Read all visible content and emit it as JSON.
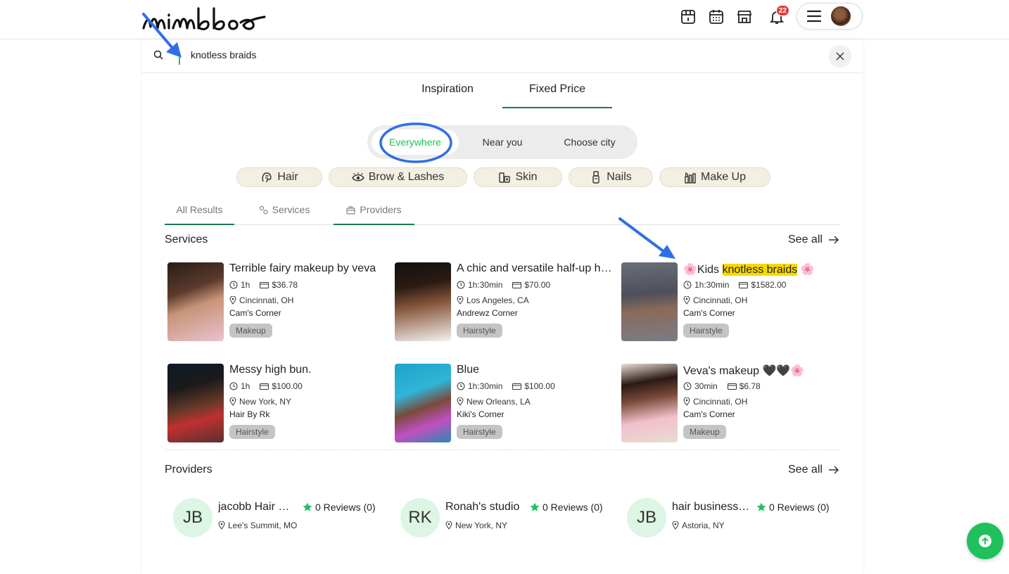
{
  "brand": {
    "logo_text": "mimbbo"
  },
  "header": {
    "nav_icons": [
      "inspiration-icon",
      "calendar-icon",
      "store-icon",
      "bell-icon"
    ],
    "notification_count": "22",
    "menu_icon": "menu-icon"
  },
  "search": {
    "query": "knotless braids",
    "clear_icon": "close-icon"
  },
  "main_tabs": [
    {
      "label": "Inspiration",
      "active": false
    },
    {
      "label": "Fixed Price",
      "active": true
    }
  ],
  "location_filter": {
    "options": [
      "Everywhere",
      "Near you",
      "Choose city"
    ],
    "selected": "Everywhere"
  },
  "categories": [
    {
      "label": "Hair",
      "icon": "hair-icon"
    },
    {
      "label": "Brow & Lashes",
      "icon": "eye-icon"
    },
    {
      "label": "Skin",
      "icon": "skincare-icon"
    },
    {
      "label": "Nails",
      "icon": "nail-polish-icon"
    },
    {
      "label": "Make Up",
      "icon": "makeup-icon"
    }
  ],
  "result_tabs": [
    {
      "label": "All Results",
      "icon": ""
    },
    {
      "label": "Services",
      "icon": "services-icon"
    },
    {
      "label": "Providers",
      "icon": "briefcase-icon"
    }
  ],
  "services_section": {
    "title": "Services",
    "see_all": "See all",
    "items": [
      {
        "title": "Terrible fairy makeup by veva",
        "duration": "1h",
        "price": "$36.78",
        "location": "Cincinnati, OH",
        "provider": "Cam's Corner",
        "tag": "Makeup"
      },
      {
        "title": "A chic and versatile half-up half-down",
        "duration": "1h:30min",
        "price": "$70.00",
        "location": "Los Angeles, CA",
        "provider": "Andrewz Corner",
        "tag": "Hairstyle"
      },
      {
        "title_prefix": "🌸Kids ",
        "title_highlight": "knotless braids",
        "title_suffix": " 🌸",
        "duration": "1h:30min",
        "price": "$1582.00",
        "location": "Cincinnati, OH",
        "provider": "Cam's Corner",
        "tag": "Hairstyle"
      },
      {
        "title": "Messy high bun.",
        "duration": "1h",
        "price": "$100.00",
        "location": "New York, NY",
        "provider": "Hair By Rk",
        "tag": "Hairstyle"
      },
      {
        "title": "Blue",
        "duration": "1h:30min",
        "price": "$100.00",
        "location": "New Orleans, LA",
        "provider": "Kiki's Corner",
        "tag": "Hairstyle"
      },
      {
        "title": "Veva's makeup 🖤🖤🌸",
        "duration": "30min",
        "price": "$6.78",
        "location": "Cincinnati, OH",
        "provider": "Cam's Corner",
        "tag": "Makeup"
      }
    ]
  },
  "providers_section": {
    "title": "Providers",
    "see_all": "See all",
    "items": [
      {
        "initials": "JB",
        "name": "jacobb Hair Studio",
        "reviews": "0 Reviews (0)",
        "location": "Lee's Summit, MO"
      },
      {
        "initials": "RK",
        "name": "Ronah's studio",
        "reviews": "0 Reviews (0)",
        "location": "New York, NY"
      },
      {
        "initials": "JB",
        "name": "hair business studio",
        "reviews": "0 Reviews (0)",
        "location": "Astoria, NY"
      }
    ]
  },
  "fab": {
    "icon": "arrow-up-icon"
  },
  "colors": {
    "accent_green": "#1ec15c",
    "tab_underline": "#1a7a4c",
    "annotation_blue": "#2f6fe6",
    "highlight": "#f8d800"
  }
}
